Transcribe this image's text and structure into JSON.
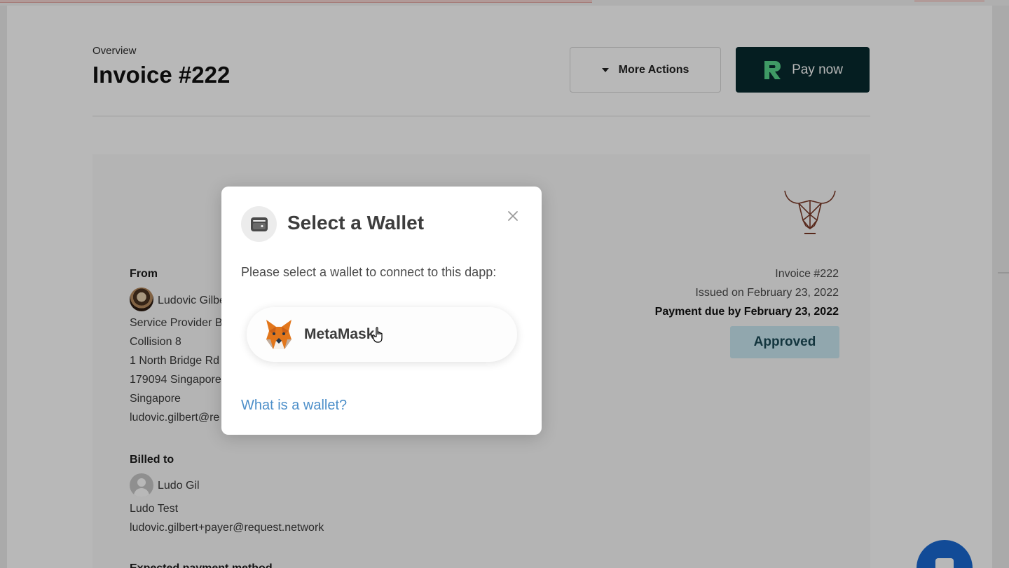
{
  "header": {
    "overview_label": "Overview",
    "title": "Invoice #222",
    "more_actions_label": "More Actions",
    "pay_now_label": "Pay now"
  },
  "invoice": {
    "from": {
      "label": "From",
      "name": "Ludovic Gilbe",
      "lines": [
        "Service Provider B",
        "Collision 8",
        "1 North Bridge Rd",
        "179094 Singapore",
        "Singapore",
        "ludovic.gilbert@re"
      ]
    },
    "billed_to": {
      "label": "Billed to",
      "name": "Ludo Gil",
      "lines": [
        "Ludo Test",
        "ludovic.gilbert+payer@request.network"
      ]
    },
    "expected_payment_label": "Expected payment method",
    "number": "Invoice #222",
    "issued": "Issued on February 23, 2022",
    "due": "Payment due by February 23, 2022",
    "status": "Approved"
  },
  "modal": {
    "title": "Select a Wallet",
    "subtitle": "Please select a wallet to connect to this dapp:",
    "wallet_option": "MetaMask",
    "help_link": "What is a wallet?"
  },
  "colors": {
    "pay_button_bg": "#072a2e",
    "brand_green": "#58d68d",
    "status_bg": "#c9e8f1",
    "link": "#4d8fc9",
    "chat_bubble": "#1969d2"
  },
  "icons": [
    "caret-down-icon",
    "request-logo-icon",
    "wallet-icon",
    "close-icon",
    "metamask-fox-icon",
    "bull-logo-icon",
    "hand-pointer-icon",
    "chat-icon"
  ]
}
